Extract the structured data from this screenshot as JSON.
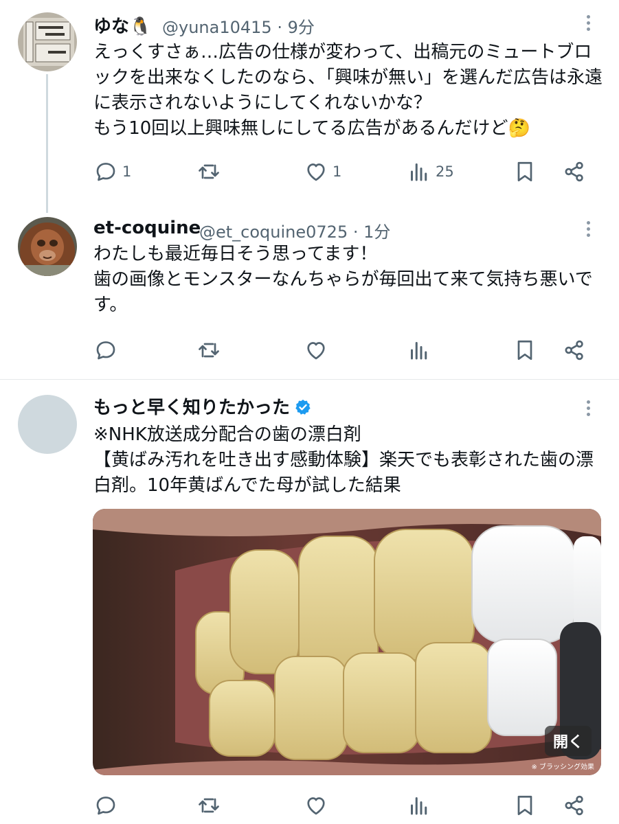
{
  "tweets": [
    {
      "name": "ゆな🐧",
      "handle": "@yuna10415",
      "sep": "·",
      "time": "9分",
      "text": "えっくすさぁ…広告の仕様が変わって、出稿元のミュートブロックを出来なくしたのなら、「興味が無い」を選んだ広告は永遠に表示されないようにしてくれないかな？\nもう10回以上興味無しにしてる広告があるんだけど🤔",
      "counts": {
        "reply": "1",
        "retweet": "",
        "like": "1",
        "views": "25"
      }
    },
    {
      "name": "et-coquine",
      "handle": "@et_coquine0725",
      "sep": "·",
      "time": "1分",
      "text": "わたしも最近毎日そう思ってます！\n歯の画像とモンスターなんちゃらが毎回出て来て気持ち悪いです。",
      "counts": {
        "reply": "",
        "retweet": "",
        "like": "",
        "views": ""
      }
    },
    {
      "name": "もっと早く知りたかった",
      "text": "※NHK放送成分配合の歯の漂白剤\n【黄ばみ汚れを吐き出す感動体験】楽天でも表彰された歯の漂白剤。10年黄ばんでた母が試した結果",
      "media": {
        "open_label": "開く",
        "note": "※ ブラッシング効果"
      }
    }
  ],
  "icons": {
    "reply": "reply-icon",
    "retweet": "retweet-icon",
    "like": "heart-icon",
    "views": "views-icon",
    "bookmark": "bookmark-icon",
    "share": "share-icon",
    "more": "more-vertical-icon",
    "verified": "verified-badge-icon"
  },
  "colors": {
    "text": "#0f1419",
    "muted": "#536471",
    "verified": "#1d9bf0",
    "line": "#cfd9de"
  }
}
